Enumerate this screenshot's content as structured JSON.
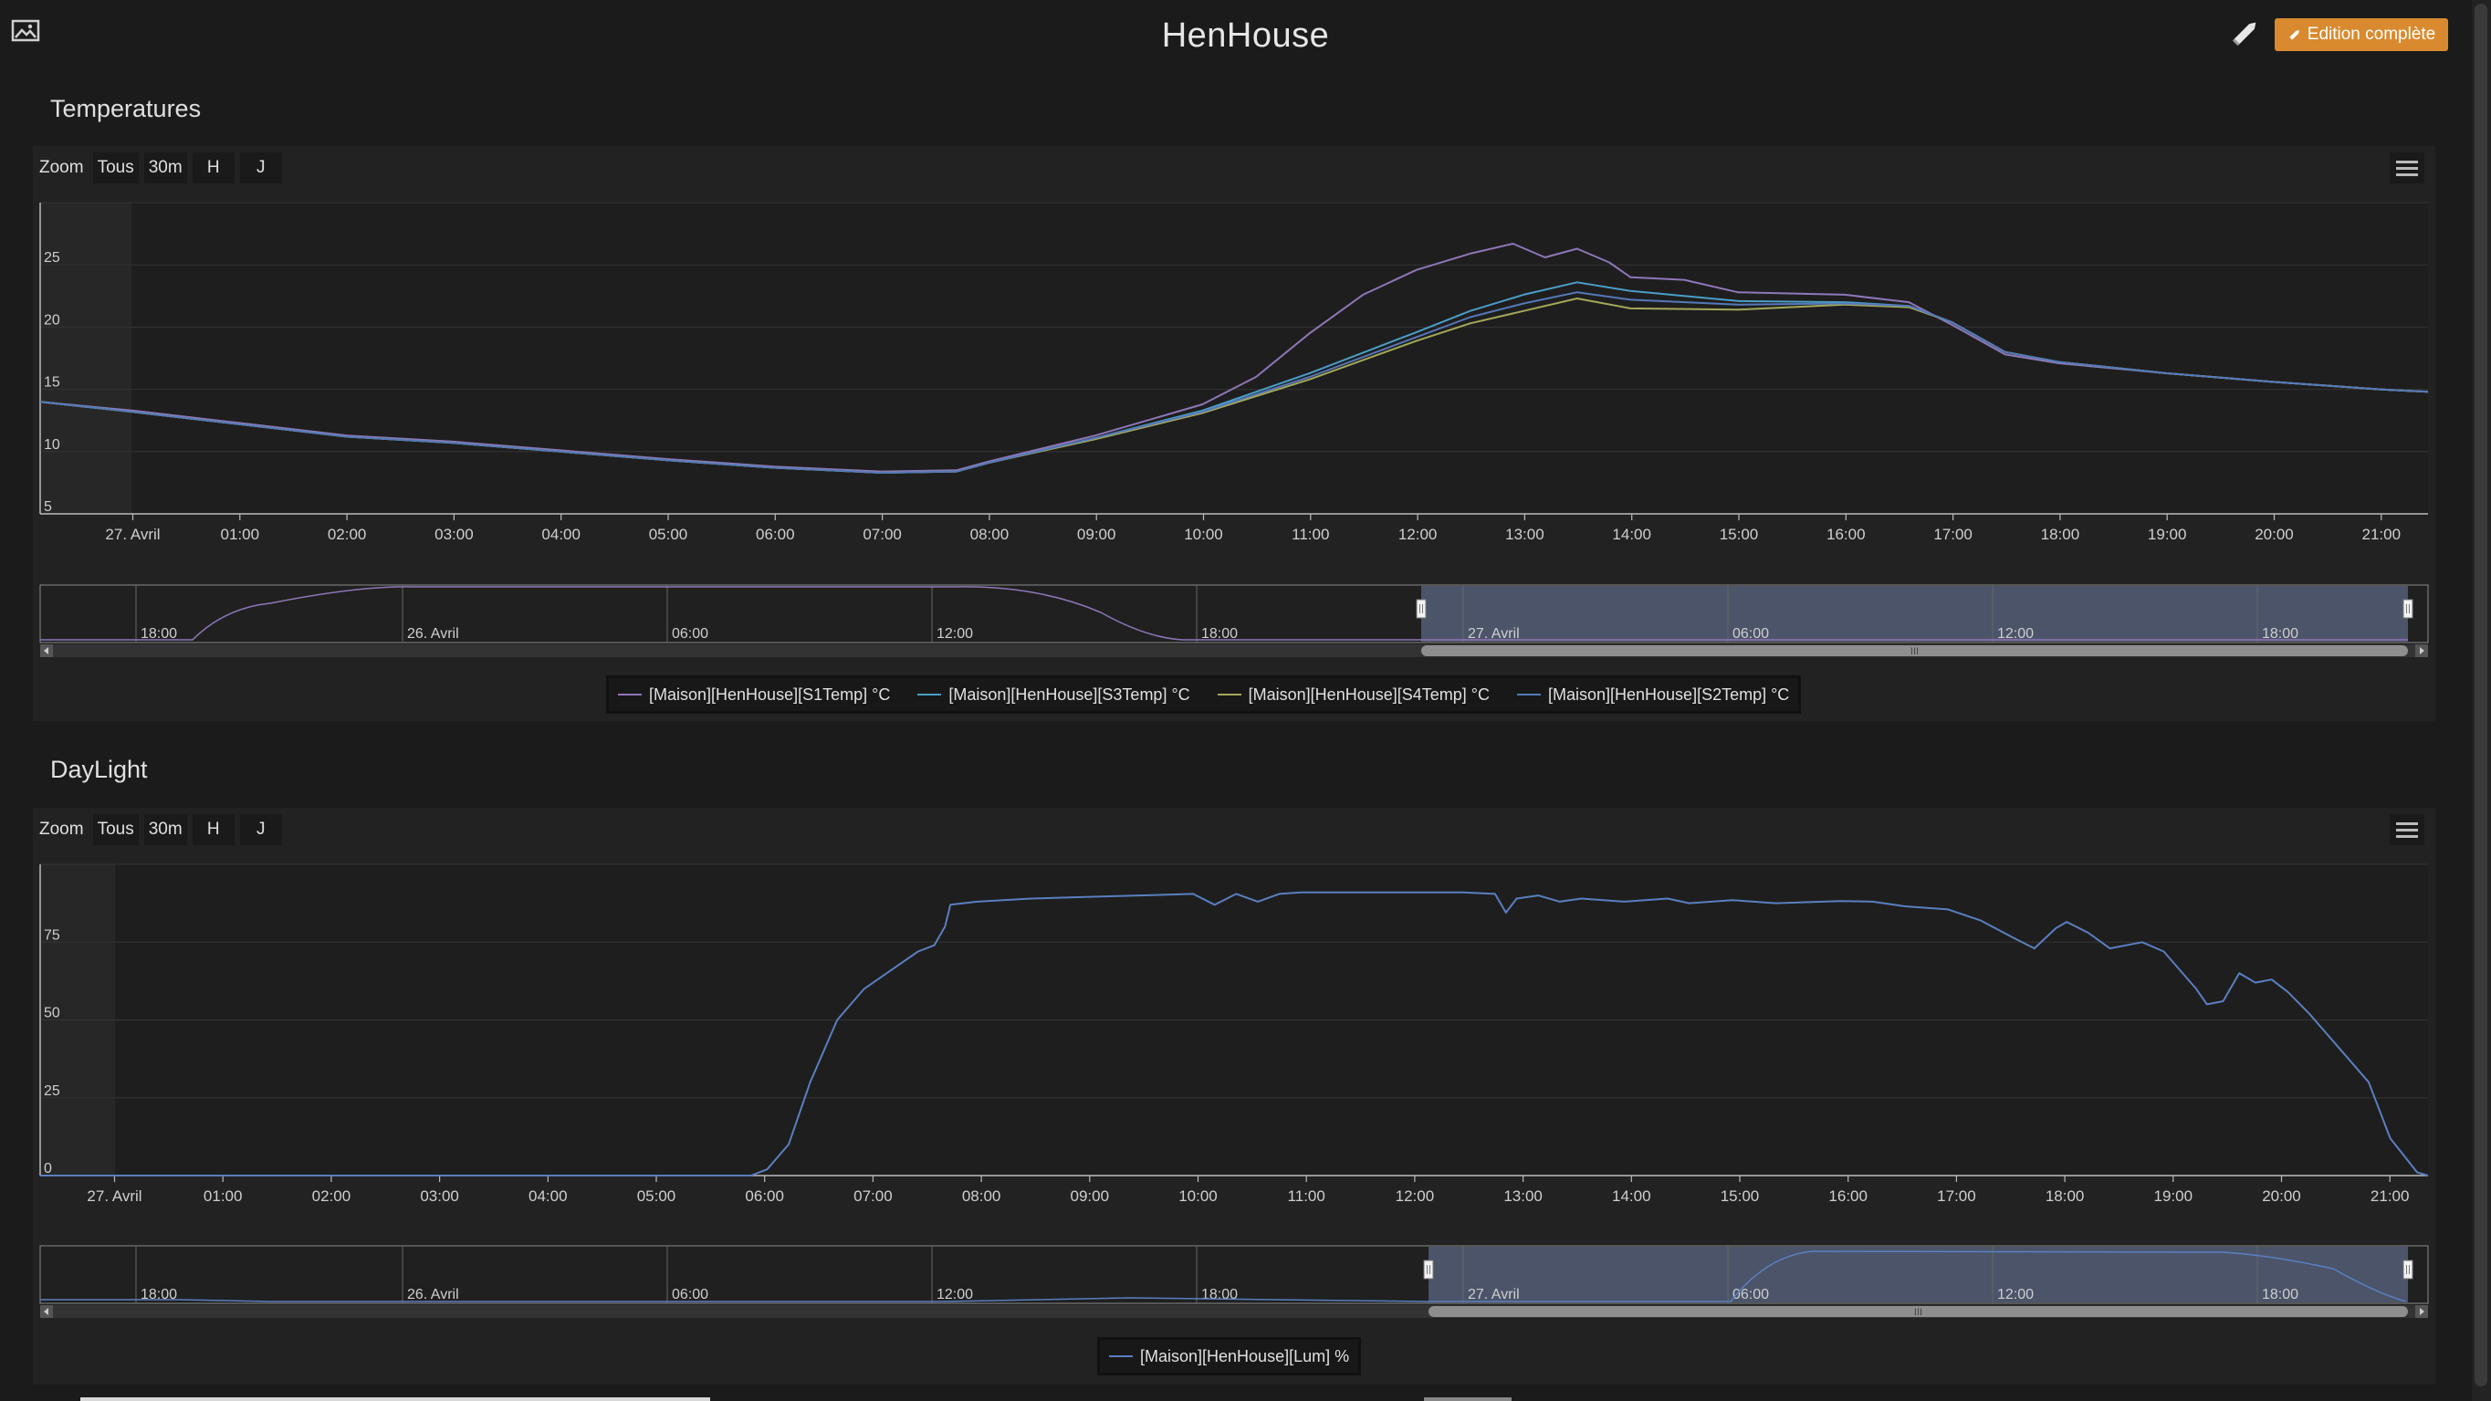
{
  "page": {
    "title": "HenHouse",
    "edit_button_label": "Edition complète",
    "icons": {
      "image": "image-icon",
      "pencil": "pencil-icon",
      "menu": "hamburger-menu-icon"
    }
  },
  "colors": {
    "background": "#1b1b1b",
    "panel": "#222222",
    "accent_button": "#d98a2e",
    "navigator_selection": "#5a6582",
    "S1Temp": "#8e77b8",
    "S3Temp": "#4a9ec7",
    "S4Temp": "#a4a85a",
    "S2Temp": "#5578b8",
    "Lum": "#5a7fc0"
  },
  "charts": [
    {
      "title": "Temperatures",
      "zoom": {
        "label": "Zoom",
        "buttons": [
          "Tous",
          "30m",
          "H",
          "J"
        ]
      },
      "navigator_ticks": [
        "18:00",
        "26. Avril",
        "06:00",
        "12:00",
        "18:00",
        "27. Avril",
        "06:00",
        "12:00",
        "18:00"
      ],
      "navigator_handle_label": "III",
      "chart_data": {
        "type": "line",
        "title": "",
        "xlabel": "",
        "ylabel": "",
        "x_ticks": [
          "27. Avril",
          "01:00",
          "02:00",
          "03:00",
          "04:00",
          "05:00",
          "06:00",
          "07:00",
          "08:00",
          "09:00",
          "10:00",
          "11:00",
          "12:00",
          "13:00",
          "14:00",
          "15:00",
          "16:00",
          "17:00",
          "18:00",
          "19:00",
          "20:00",
          "21:00"
        ],
        "y_ticks": [
          "5",
          "10",
          "15",
          "20",
          "25"
        ],
        "ylim": [
          5,
          30
        ],
        "x_unit": "hours since 27. Avril 00:00",
        "xlim": [
          -0.86,
          21.45
        ],
        "grid": true,
        "legend_position": "bottom-center",
        "series": [
          {
            "name": "[Maison][HenHouse][S1Temp] °C",
            "color": "#8e77b8",
            "points": [
              [
                -0.86,
                14
              ],
              [
                0,
                13.3
              ],
              [
                1,
                12.3
              ],
              [
                2,
                11.3
              ],
              [
                3,
                10.8
              ],
              [
                4,
                10.1
              ],
              [
                5,
                9.4
              ],
              [
                6,
                8.8
              ],
              [
                7,
                8.4
              ],
              [
                7.7,
                8.5
              ],
              [
                8,
                9.2
              ],
              [
                9,
                11.3
              ],
              [
                10,
                13.8
              ],
              [
                10.5,
                16
              ],
              [
                11,
                19.5
              ],
              [
                11.5,
                22.6
              ],
              [
                12,
                24.6
              ],
              [
                12.5,
                25.9
              ],
              [
                12.9,
                26.7
              ],
              [
                13.2,
                25.6
              ],
              [
                13.5,
                26.3
              ],
              [
                13.8,
                25.2
              ],
              [
                14,
                24
              ],
              [
                14.5,
                23.8
              ],
              [
                15,
                22.8
              ],
              [
                16,
                22.6
              ],
              [
                16.6,
                22
              ],
              [
                17,
                20.2
              ],
              [
                17.5,
                17.8
              ],
              [
                18,
                17.1
              ],
              [
                19,
                16.3
              ],
              [
                20,
                15.6
              ],
              [
                21,
                15
              ],
              [
                21.45,
                14.8
              ]
            ]
          },
          {
            "name": "[Maison][HenHouse][S3Temp] °C",
            "color": "#4a9ec7",
            "points": [
              [
                -0.86,
                14
              ],
              [
                0,
                13.2
              ],
              [
                1,
                12.2
              ],
              [
                2,
                11.2
              ],
              [
                3,
                10.7
              ],
              [
                4,
                10
              ],
              [
                5,
                9.3
              ],
              [
                6,
                8.7
              ],
              [
                7,
                8.3
              ],
              [
                7.7,
                8.4
              ],
              [
                8,
                9.1
              ],
              [
                9,
                11.1
              ],
              [
                10,
                13.3
              ],
              [
                11,
                16.3
              ],
              [
                12,
                19.6
              ],
              [
                12.5,
                21.3
              ],
              [
                13,
                22.6
              ],
              [
                13.5,
                23.6
              ],
              [
                14,
                22.9
              ],
              [
                15,
                22.1
              ],
              [
                16,
                22
              ],
              [
                16.6,
                21.7
              ],
              [
                17,
                20.4
              ],
              [
                17.5,
                18
              ],
              [
                18,
                17.2
              ],
              [
                19,
                16.3
              ],
              [
                20,
                15.6
              ],
              [
                21,
                15
              ],
              [
                21.45,
                14.8
              ]
            ]
          },
          {
            "name": "[Maison][HenHouse][S4Temp] °C",
            "color": "#a4a85a",
            "points": [
              [
                -0.86,
                14
              ],
              [
                0,
                13.2
              ],
              [
                1,
                12.2
              ],
              [
                2,
                11.2
              ],
              [
                3,
                10.7
              ],
              [
                4,
                10
              ],
              [
                5,
                9.3
              ],
              [
                6,
                8.7
              ],
              [
                7,
                8.3
              ],
              [
                7.7,
                8.4
              ],
              [
                8,
                9.1
              ],
              [
                9,
                11
              ],
              [
                10,
                13.1
              ],
              [
                11,
                15.8
              ],
              [
                12,
                18.9
              ],
              [
                12.5,
                20.3
              ],
              [
                13,
                21.3
              ],
              [
                13.5,
                22.3
              ],
              [
                14,
                21.5
              ],
              [
                15,
                21.4
              ],
              [
                16,
                21.8
              ],
              [
                16.6,
                21.6
              ],
              [
                17,
                20.4
              ],
              [
                17.5,
                18
              ],
              [
                18,
                17.2
              ],
              [
                19,
                16.3
              ],
              [
                20,
                15.6
              ],
              [
                21,
                15
              ],
              [
                21.45,
                14.8
              ]
            ]
          },
          {
            "name": "[Maison][HenHouse][S2Temp] °C",
            "color": "#5578b8",
            "points": [
              [
                -0.86,
                14
              ],
              [
                0,
                13.2
              ],
              [
                1,
                12.2
              ],
              [
                2,
                11.2
              ],
              [
                3,
                10.7
              ],
              [
                4,
                10
              ],
              [
                5,
                9.3
              ],
              [
                6,
                8.7
              ],
              [
                7,
                8.3
              ],
              [
                7.7,
                8.4
              ],
              [
                8,
                9.1
              ],
              [
                9,
                11.1
              ],
              [
                10,
                13.2
              ],
              [
                11,
                16
              ],
              [
                12,
                19.2
              ],
              [
                12.5,
                20.8
              ],
              [
                13,
                21.9
              ],
              [
                13.5,
                22.8
              ],
              [
                14,
                22.2
              ],
              [
                15,
                21.8
              ],
              [
                16,
                21.9
              ],
              [
                16.6,
                21.7
              ],
              [
                17,
                20.4
              ],
              [
                17.5,
                18
              ],
              [
                18,
                17.2
              ],
              [
                19,
                16.3
              ],
              [
                20,
                15.6
              ],
              [
                21,
                15
              ],
              [
                21.45,
                14.8
              ]
            ]
          }
        ]
      }
    },
    {
      "title": "DayLight",
      "zoom": {
        "label": "Zoom",
        "buttons": [
          "Tous",
          "30m",
          "H",
          "J"
        ]
      },
      "navigator_ticks": [
        "18:00",
        "26. Avril",
        "06:00",
        "12:00",
        "18:00",
        "27. Avril",
        "06:00",
        "12:00",
        "18:00"
      ],
      "navigator_handle_label": "III",
      "chart_data": {
        "type": "line",
        "title": "",
        "xlabel": "",
        "ylabel": "",
        "x_ticks": [
          "27. Avril",
          "01:00",
          "02:00",
          "03:00",
          "04:00",
          "05:00",
          "06:00",
          "07:00",
          "08:00",
          "09:00",
          "10:00",
          "11:00",
          "12:00",
          "13:00",
          "14:00",
          "15:00",
          "16:00",
          "17:00",
          "18:00",
          "19:00",
          "20:00",
          "21:00"
        ],
        "y_ticks": [
          "0",
          "25",
          "50",
          "75"
        ],
        "ylim": [
          0,
          100
        ],
        "x_unit": "hours since 27. Avril 00:00",
        "xlim": [
          -0.69,
          21.45
        ],
        "grid": true,
        "legend_position": "bottom-center",
        "series": [
          {
            "name": "[Maison][HenHouse][Lum] %",
            "color": "#5a7fc0",
            "points": [
              [
                -0.69,
                0
              ],
              [
                5.9,
                0
              ],
              [
                6.05,
                2
              ],
              [
                6.25,
                10
              ],
              [
                6.45,
                30
              ],
              [
                6.7,
                50
              ],
              [
                6.95,
                60
              ],
              [
                7.2,
                66
              ],
              [
                7.45,
                72
              ],
              [
                7.6,
                74
              ],
              [
                7.7,
                80
              ],
              [
                7.75,
                87
              ],
              [
                8,
                88
              ],
              [
                8.5,
                89
              ],
              [
                9,
                89.5
              ],
              [
                9.5,
                90
              ],
              [
                10,
                90.5
              ],
              [
                10.2,
                87
              ],
              [
                10.4,
                90.5
              ],
              [
                10.6,
                88
              ],
              [
                10.8,
                90.5
              ],
              [
                11,
                91
              ],
              [
                12,
                91
              ],
              [
                12.5,
                91
              ],
              [
                12.8,
                90.5
              ],
              [
                12.9,
                84.5
              ],
              [
                13,
                89
              ],
              [
                13.2,
                90
              ],
              [
                13.4,
                88
              ],
              [
                13.6,
                89
              ],
              [
                14,
                88
              ],
              [
                14.4,
                89
              ],
              [
                14.6,
                87.5
              ],
              [
                15,
                88.5
              ],
              [
                15.4,
                87.5
              ],
              [
                16,
                88.2
              ],
              [
                16.3,
                88
              ],
              [
                16.6,
                86.5
              ],
              [
                17,
                85.5
              ],
              [
                17.3,
                82
              ],
              [
                17.6,
                76.5
              ],
              [
                17.8,
                73
              ],
              [
                18,
                79.5
              ],
              [
                18.1,
                81.5
              ],
              [
                18.3,
                78
              ],
              [
                18.5,
                73
              ],
              [
                18.8,
                75
              ],
              [
                19,
                72
              ],
              [
                19.3,
                60
              ],
              [
                19.4,
                55
              ],
              [
                19.55,
                56
              ],
              [
                19.7,
                65
              ],
              [
                19.85,
                62
              ],
              [
                20,
                63
              ],
              [
                20.15,
                59
              ],
              [
                20.35,
                52
              ],
              [
                20.6,
                42
              ],
              [
                20.9,
                30
              ],
              [
                21.1,
                12
              ],
              [
                21.35,
                1
              ],
              [
                21.45,
                0
              ]
            ]
          }
        ]
      }
    }
  ]
}
